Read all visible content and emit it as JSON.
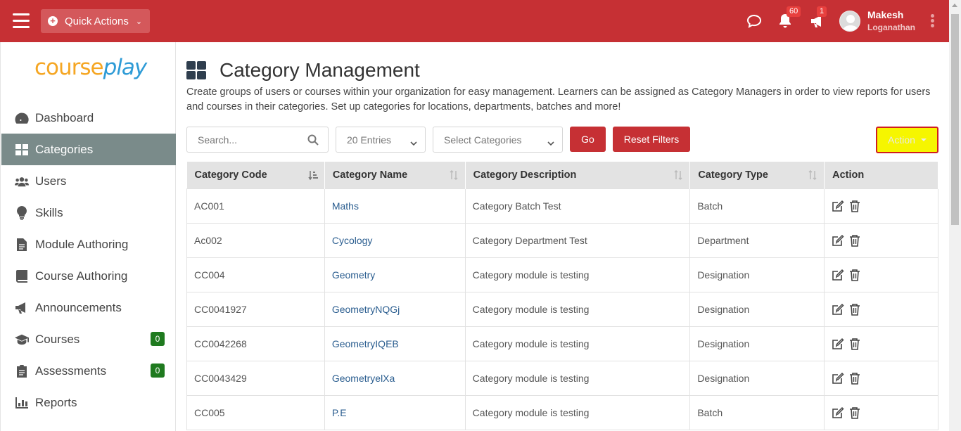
{
  "topbar": {
    "quick_actions_label": "Quick Actions",
    "notifications_count": "60",
    "announcements_count": "1",
    "user_first": "Makesh",
    "user_last": "Loganathan"
  },
  "logo": {
    "part1": "course",
    "part2": "play"
  },
  "sidebar": {
    "items": [
      {
        "label": "Dashboard"
      },
      {
        "label": "Categories"
      },
      {
        "label": "Users"
      },
      {
        "label": "Skills"
      },
      {
        "label": "Module Authoring"
      },
      {
        "label": "Course Authoring"
      },
      {
        "label": "Announcements"
      },
      {
        "label": "Courses",
        "badge": "0"
      },
      {
        "label": "Assessments",
        "badge": "0"
      },
      {
        "label": "Reports"
      }
    ]
  },
  "page": {
    "title": "Category Management",
    "description": "Create groups of users or courses within your organization for easy management. Learners can be assigned as Category Managers in order to view reports for users and courses in their categories. Set up categories for locations, departments, batches and more!"
  },
  "filters": {
    "search_placeholder": "Search...",
    "entries": "20 Entries",
    "categories": "Select Categories",
    "go_label": "Go",
    "reset_label": "Reset Filters",
    "action_label": "Action"
  },
  "table": {
    "headers": [
      "Category Code",
      "Category Name",
      "Category Description",
      "Category Type",
      "Action"
    ],
    "rows": [
      [
        "AC001",
        "Maths",
        "Category Batch Test",
        "Batch"
      ],
      [
        "Ac002",
        "Cycology",
        "Category Department Test",
        "Department"
      ],
      [
        "CC004",
        "Geometry",
        "Category module is testing",
        "Designation"
      ],
      [
        "CC0041927",
        "GeometryNQGj",
        "Category module is testing",
        "Designation"
      ],
      [
        "CC0042268",
        "GeometryIQEB",
        "Category module is testing",
        "Designation"
      ],
      [
        "CC0043429",
        "GeometryelXa",
        "Category module is testing",
        "Designation"
      ],
      [
        "CC005",
        "P.E",
        "Category module is testing",
        "Batch"
      ]
    ]
  },
  "colors": {
    "topbar": "#c63034",
    "active_nav": "#7a8b8a",
    "action_button": "#f6f600",
    "badge_green": "#1f7a1f"
  }
}
